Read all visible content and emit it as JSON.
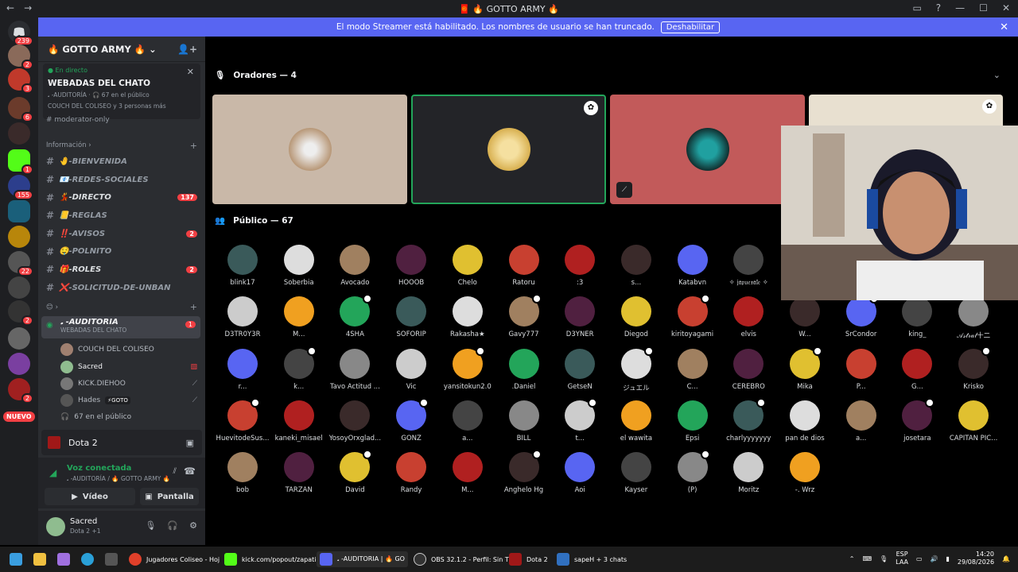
{
  "window": {
    "title": "🧧 🔥 GOTTO ARMY 🔥"
  },
  "streamer_banner": {
    "text": "El modo Streamer está habilitado. Los nombres de usuario se han truncado.",
    "button": "Deshabilitar"
  },
  "guild_badges": {
    "first": "239",
    "second": "2",
    "third": "3",
    "fourth": "6",
    "fifth": "1",
    "sixth": "155",
    "seventh": "22",
    "eighth": "2",
    "ninth": "2",
    "new": "NUEVO"
  },
  "server": {
    "name": "🔥 GOTTO ARMY 🔥"
  },
  "live": {
    "status": "En directo",
    "stage": "WEBADAS DEL CHATO",
    "channel": "𝅘 -AUDITORÍA · 🎧 67 en el público",
    "people": "COUCH DEL COLISEO y 3 personas más",
    "partial": "moderator-only"
  },
  "categories": {
    "info": "Información ›",
    "voice": "😊 ›"
  },
  "channels": [
    {
      "name": "🤚-BIENVENIDA",
      "badge": ""
    },
    {
      "name": "📧-REDES-SOCIALES",
      "badge": ""
    },
    {
      "name": "💃-DIRECTO",
      "badge": "137"
    },
    {
      "name": "📒-REGLAS",
      "badge": ""
    },
    {
      "name": "‼️-AVISOS",
      "badge": "2"
    },
    {
      "name": "🤤-POLNITO",
      "badge": ""
    },
    {
      "name": "🎁-ROLES",
      "badge": "2"
    },
    {
      "name": "❌-SOLICITUD-DE-UNBAN",
      "badge": ""
    }
  ],
  "voice_channel": {
    "name": "𝅘 -AUDITORIA",
    "subtitle": "WEBADAS DEL CHATO",
    "badge": "1"
  },
  "voice_users": [
    {
      "name": "COUCH DEL COLISEO",
      "tag": ""
    },
    {
      "name": "Sacred",
      "tag": ""
    },
    {
      "name": "KICK.DIEHOO",
      "tag": ""
    },
    {
      "name": "Hades",
      "tag": "⚡GOTO"
    }
  ],
  "voice_footer": "67 en el público",
  "game": {
    "name": "Dota 2"
  },
  "voice_connected": {
    "status": "Voz conectada",
    "location": "𝅘 -AUDITORÍA / 🔥 GOTTO ARMY 🔥",
    "video": "Vídeo",
    "screen": "Pantalla"
  },
  "user": {
    "name": "Sacred",
    "status": "Dota 2 +1"
  },
  "stage": {
    "speakers_header": "Oradores — 4",
    "audience_header": "Público — 67",
    "audience": [
      [
        "blink17",
        "Soberbia",
        "Avocado",
        "HOOOB",
        "Chelo",
        "Ratoru",
        ":3",
        "s...",
        "Katabvn",
        "✧ 𝔧𝔞𝔭𝔲𝔢𝔵𝔞𝔩𝔢 ✧",
        "",
        "",
        "",
        ""
      ],
      [
        "D3TR0Y3R",
        "M...",
        "4SHA",
        "SOFORIP",
        "Rakasha★",
        "Gavy777",
        "D3YNER",
        "Diegod",
        "kiritoyagami",
        "elvis",
        "W...",
        "SrCondor",
        "king_",
        "𝒜𝓈𝓉𝓇𝒶𝓁十二"
      ],
      [
        "r...",
        "k...",
        "Tavo Actitud ...",
        "Vic",
        "yansitokun2.0",
        ".Daniel",
        "GetseN",
        "ジュエル",
        "C...",
        "CEREBRO",
        "Mika",
        "P...",
        "G...",
        "Krisko"
      ],
      [
        "HuevitodeSus...",
        "kaneki_misael",
        "YosoyOrxglad...",
        "GONZ",
        "a...",
        "BILL",
        "t...",
        "el wawita",
        "Epsi",
        "charlyyyyyyy",
        "pan de dios",
        "a...",
        "josetara",
        "CAPITAN PIC..."
      ],
      [
        "bob",
        "TARZÁN",
        "David",
        "Randy",
        "M...",
        "Anghelo Hg",
        "Aoi",
        "Kayser",
        "(P)",
        "Moritz",
        "-. Wrz"
      ]
    ]
  },
  "taskbar": {
    "items": [
      "Jugadores Coliseo - Hoj",
      "kick.com/popout/zapati",
      "𝅘 -AUDITORIA | 🔥 GO",
      "OBS 32.1.2 - Perfil: Sin Tí",
      "Dota 2",
      "sapeH + 3 chats"
    ],
    "lang": "ESP",
    "lang2": "LAA",
    "time": "14:20",
    "date": "29/08/2026"
  },
  "colors": {
    "blurple": "#5865f2",
    "green": "#23a55a",
    "red": "#f23f43",
    "bg_sidebar": "#2b2d31",
    "bg_guilds": "#1e1f22"
  }
}
